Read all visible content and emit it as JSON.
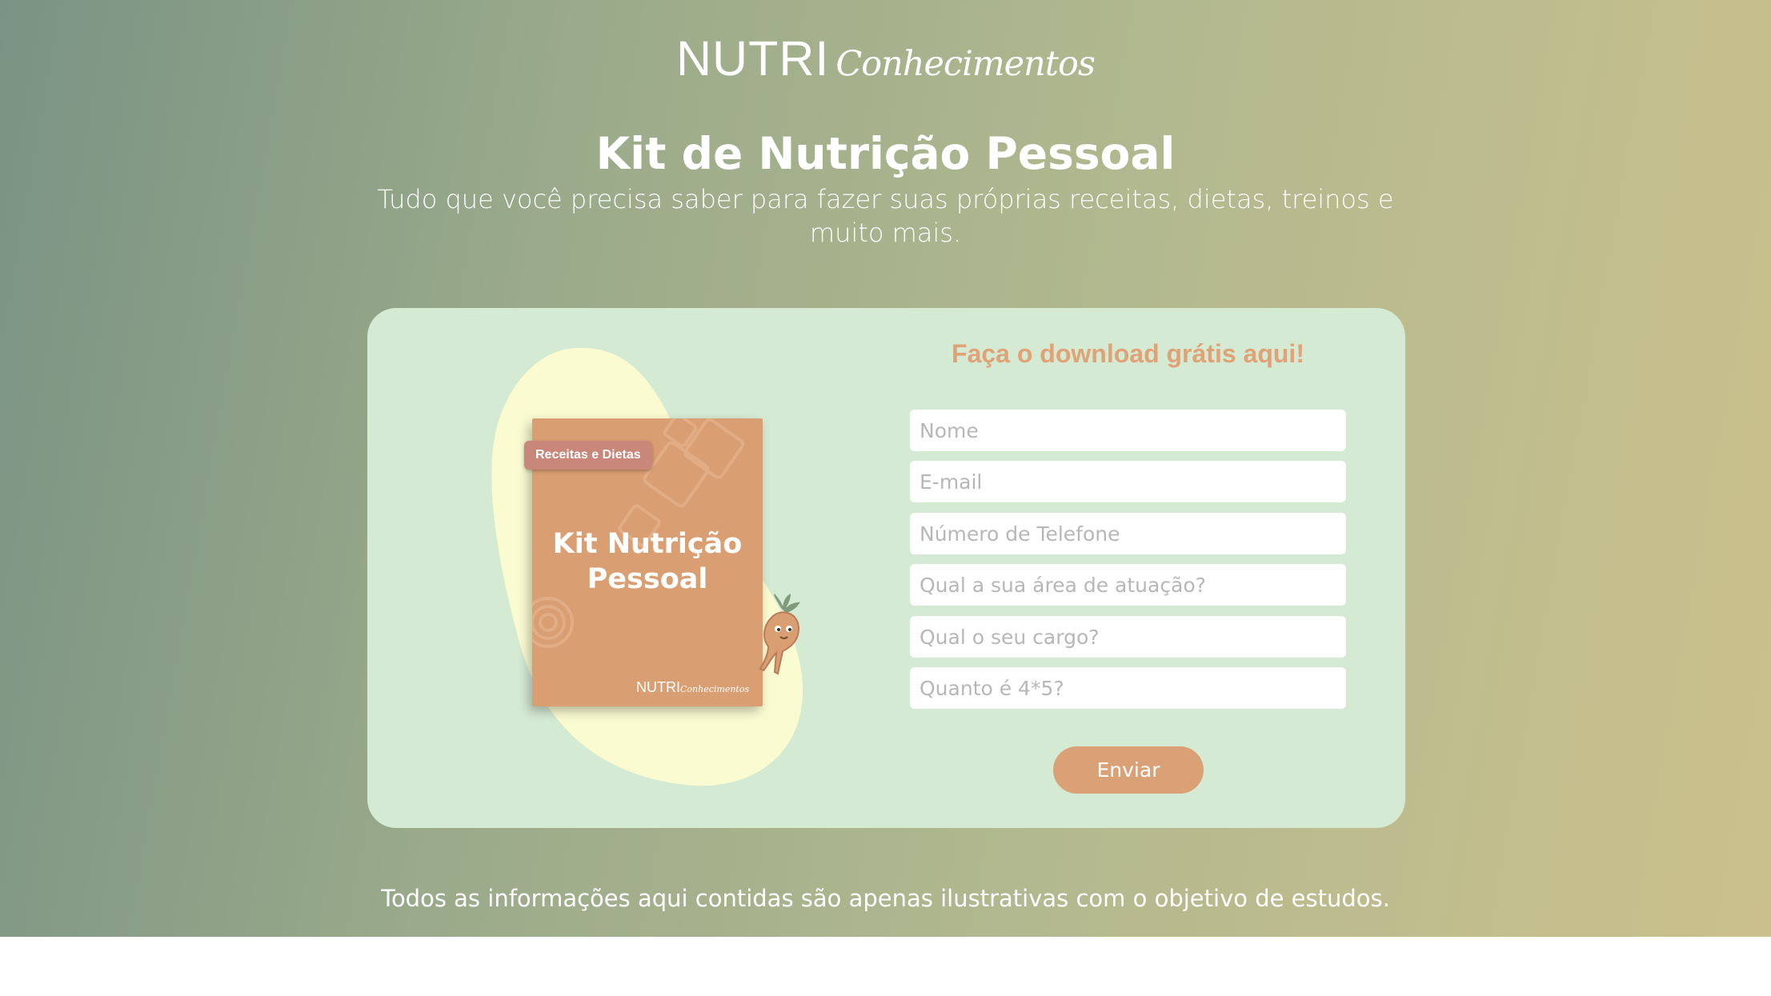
{
  "brand": {
    "logo_main": "NUTRI",
    "logo_script": "Conhecimentos"
  },
  "hero": {
    "title": "Kit de Nutrição Pessoal",
    "subtitle": "Tudo que você precisa saber para fazer suas próprias receitas, dietas, treinos e muito mais."
  },
  "ebook": {
    "tag": "Receitas e Dietas",
    "title": "Kit Nutrição Pessoal",
    "logo_main": "NUTRI",
    "logo_script": "Conhecimentos"
  },
  "form": {
    "title": "Faça o download grátis aqui!",
    "fields": {
      "name": {
        "placeholder": "Nome"
      },
      "email": {
        "placeholder": "E-mail"
      },
      "phone": {
        "placeholder": "Número de Telefone"
      },
      "area": {
        "placeholder": "Qual a sua área de atuação?"
      },
      "role": {
        "placeholder": "Qual o seu cargo?"
      },
      "captcha": {
        "placeholder": "Quanto é 4*5?"
      }
    },
    "submit_label": "Enviar"
  },
  "footer": {
    "disclaimer": "Todos as informações aqui contidas são apenas ilustrativas com o objetivo de estudos."
  },
  "colors": {
    "accent": "#dba176",
    "card_bg": "#d5ead3",
    "blob": "#fbfbd2",
    "ebook_cover": "#d99f72",
    "tag": "#c9877a"
  }
}
